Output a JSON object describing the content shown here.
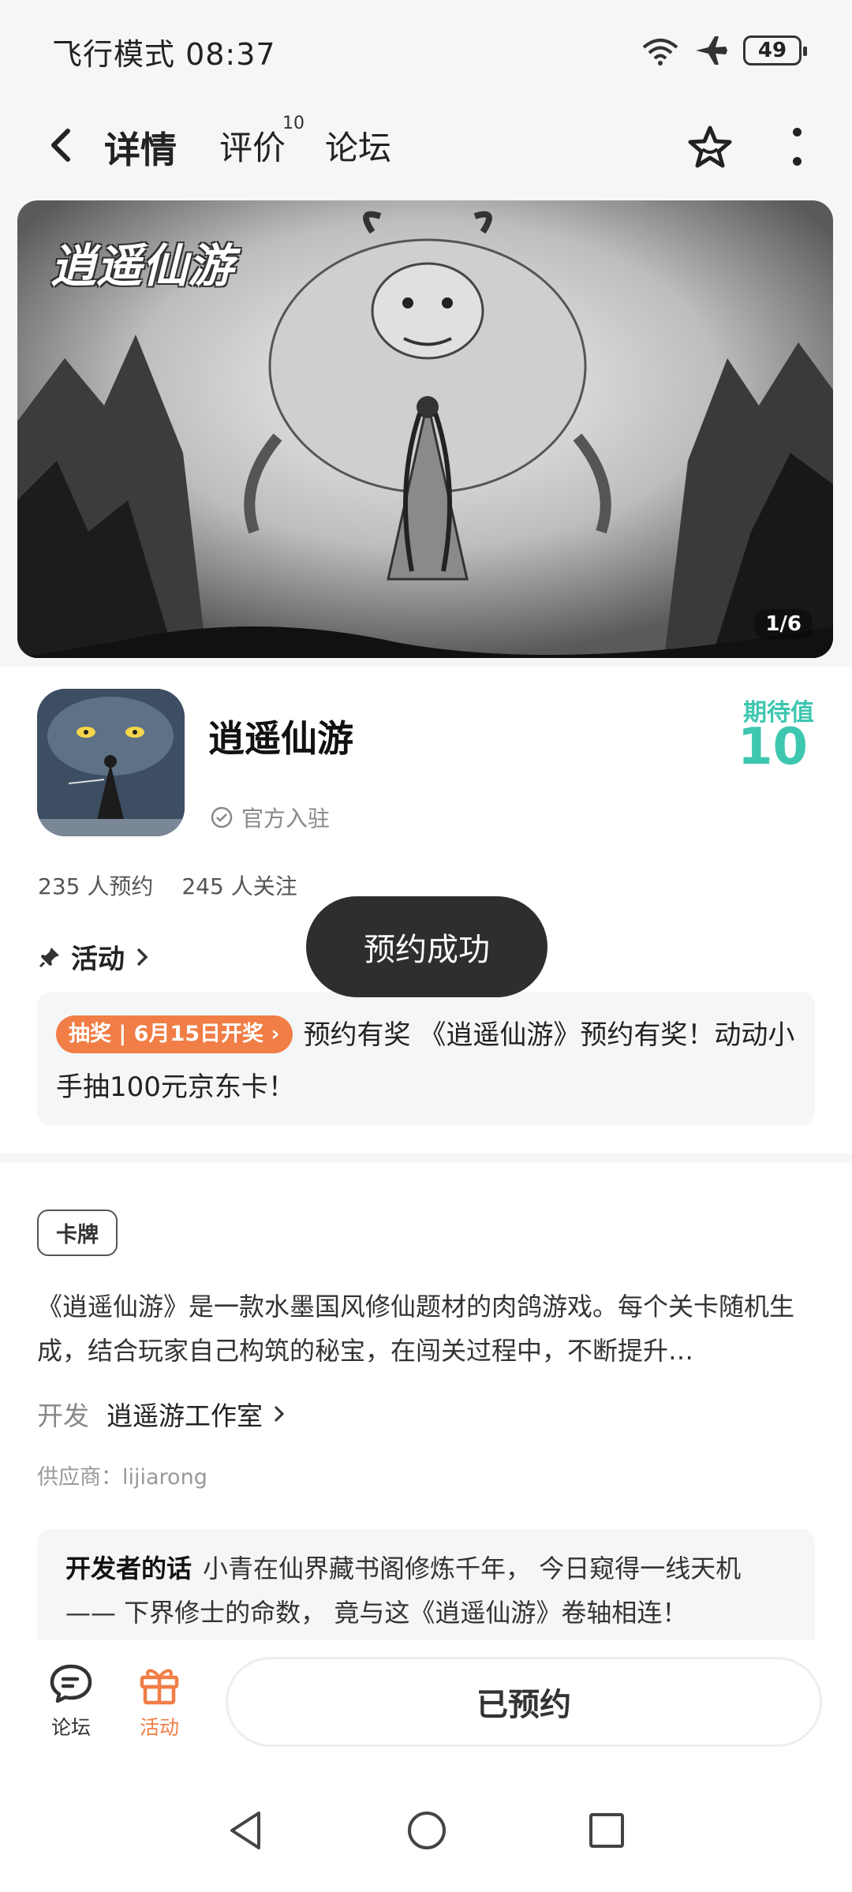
{
  "status_bar": {
    "left_text": "飞行模式 08:37",
    "battery": "49"
  },
  "nav": {
    "tabs": [
      {
        "label": "详情"
      },
      {
        "label": "评价",
        "badge": "10"
      },
      {
        "label": "论坛"
      }
    ]
  },
  "banner": {
    "logo_text": "逍遥仙游",
    "pager": "1/6"
  },
  "app": {
    "name": "逍遥仙游",
    "official_label": "官方入驻",
    "expect_label": "期待值",
    "expect_value": "10",
    "reservations": "235 人预约",
    "followers": "245 人关注"
  },
  "activity": {
    "title": "活动",
    "tag": "抽奖 | 6月15日开奖 ›",
    "text": "预约有奖 《逍遥仙游》预约有奖！动动小手抽100元京东卡！"
  },
  "toast": "预约成功",
  "details": {
    "genre_tag": "卡牌",
    "description": "《逍遥仙游》是一款水墨国风修仙题材的肉鸽游戏。每个关卡随机生成，结合玩家自己构筑的秘宝，在闯关过程中，不断提升…",
    "developer_label": "开发",
    "developer_name": "逍遥游工作室",
    "supplier": "供应商：lijiarong",
    "dev_words_title": "开发者的话",
    "dev_words_text": "小青在仙界藏书阁修炼千年， 今日窥得一线天机 —— 下界修士的命数， 竟与这《逍遥仙游》卷轴相连！"
  },
  "bottom_bar": {
    "forum_label": "论坛",
    "activity_label": "活动",
    "reserved_button": "已预约"
  },
  "colors": {
    "accent_teal": "#3ec7b0",
    "accent_orange": "#f07e46",
    "toast_bg": "#2e2e2e"
  }
}
